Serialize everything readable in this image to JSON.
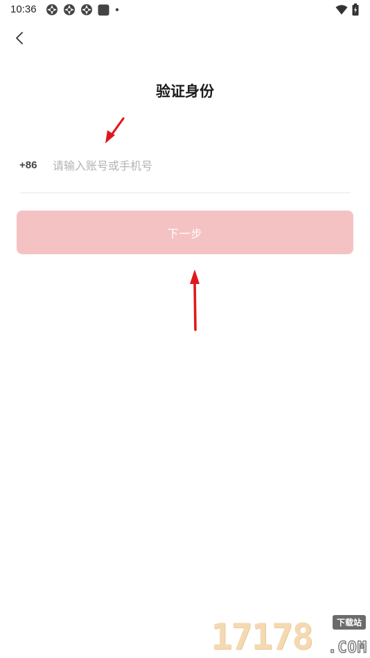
{
  "status_bar": {
    "time": "10:36"
  },
  "nav": {
    "back_icon": "chevron-left-icon"
  },
  "page": {
    "title": "验证身份"
  },
  "phone": {
    "country_code": "+86",
    "placeholder": "请输入账号或手机号",
    "value": ""
  },
  "actions": {
    "next_label": "下一步"
  },
  "watermark": {
    "digits": "17178",
    "badge": "下载站",
    "suffix": ".COM"
  },
  "colors": {
    "button_bg": "#f5c2c3",
    "arrow": "#e0181c",
    "divider": "#e6e6e6"
  }
}
